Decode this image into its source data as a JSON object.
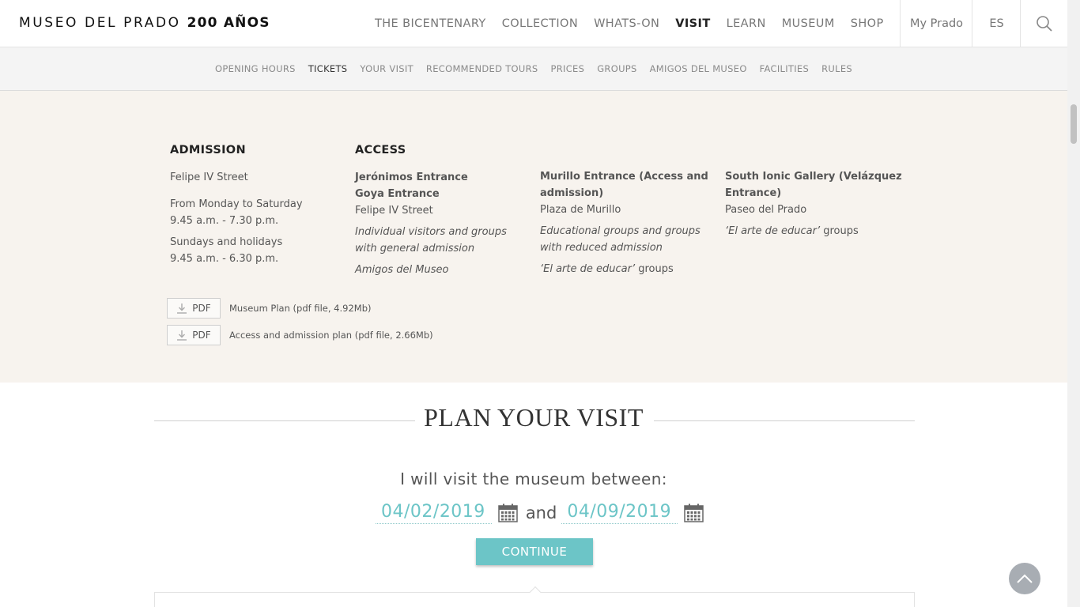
{
  "header": {
    "logo_text": "MUSEO DEL PRADO",
    "logo_bold": "200 AÑOS",
    "nav": [
      "THE BICENTENARY",
      "COLLECTION",
      "WHATS-ON",
      "VISIT",
      "LEARN",
      "MUSEUM",
      "SHOP"
    ],
    "active_nav": "VISIT",
    "my_prado": "My Prado",
    "language": "ES"
  },
  "subnav": {
    "items": [
      "OPENING HOURS",
      "TICKETS",
      "YOUR VISIT",
      "RECOMMENDED TOURS",
      "PRICES",
      "GROUPS",
      "AMIGOS DEL MUSEO",
      "FACILITIES",
      "RULES"
    ],
    "active": "TICKETS"
  },
  "admission": {
    "heading": "ADMISSION",
    "street": "Felipe IV Street",
    "weekday_days": "From Monday to Saturday",
    "weekday_hours": "9.45 a.m. - 7.30 p.m.",
    "sunday_days": "Sundays and holidays",
    "sunday_hours": "9.45 a.m. - 6.30 p.m."
  },
  "access": {
    "heading": "ACCESS",
    "jeronimos": {
      "name1": "Jerónimos Entrance",
      "name2": "Goya Entrance",
      "place": "Felipe IV Street",
      "note1": "Individual visitors and groups with general admission",
      "note2": "Amigos del Museo"
    },
    "murillo": {
      "name": "Murillo Entrance (Access and admission)",
      "place": "Plaza de Murillo",
      "note1": "Educational groups and groups with reduced admission",
      "note2_italic": "‘El arte de educar’",
      "note2_rest": " groups"
    },
    "south": {
      "name": "South Ionic Gallery (Velázquez Entrance)",
      "place": "Paseo del Prado",
      "note_italic": "‘El arte de educar’",
      "note_rest": " groups"
    }
  },
  "downloads": [
    {
      "button": "PDF",
      "label": "Museum Plan (pdf file, 4.92Mb)"
    },
    {
      "button": "PDF",
      "label": "Access and admission plan (pdf file, 2.66Mb)"
    }
  ],
  "plan": {
    "title": "PLAN YOUR VISIT",
    "question": "I will visit the museum between:",
    "date_from": "04/02/2019",
    "connector": "and",
    "date_to": "04/09/2019",
    "continue_label": "CONTINUE"
  },
  "colors": {
    "accent": "#6cc5c7",
    "band_bg": "#f7f3ee"
  }
}
